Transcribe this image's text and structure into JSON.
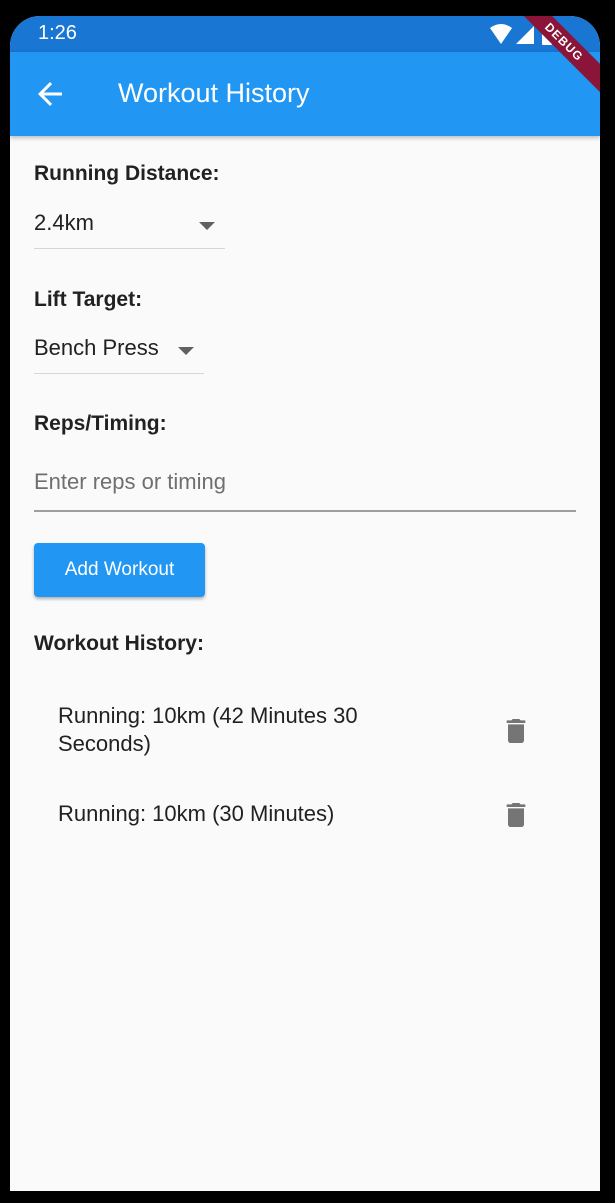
{
  "status_bar": {
    "time": "1:26",
    "icons": [
      "wifi-icon",
      "cellular-signal-icon",
      "battery-icon"
    ],
    "debug_banner": "DEBUG"
  },
  "app_bar": {
    "title": "Workout History",
    "back_icon": "arrow-back-icon"
  },
  "form": {
    "running_distance": {
      "label": "Running Distance:",
      "selected": "2.4km"
    },
    "lift_target": {
      "label": "Lift Target:",
      "selected": "Bench Press"
    },
    "reps_timing": {
      "label": "Reps/Timing:",
      "placeholder": "Enter reps or timing",
      "value": ""
    },
    "add_button_label": "Add Workout"
  },
  "history": {
    "title": "Workout History:",
    "items": [
      {
        "text": "Running: 10km (42 Minutes 30 Seconds)",
        "action_icon": "trash-icon"
      },
      {
        "text": "Running: 10km (30 Minutes)",
        "action_icon": "trash-icon"
      }
    ]
  },
  "colors": {
    "primary": "#2196f3",
    "status_bar": "#1976d2",
    "background": "#fafafa",
    "text": "#212121",
    "icon_grey": "#757575",
    "debug_banner": "#8a1538"
  }
}
